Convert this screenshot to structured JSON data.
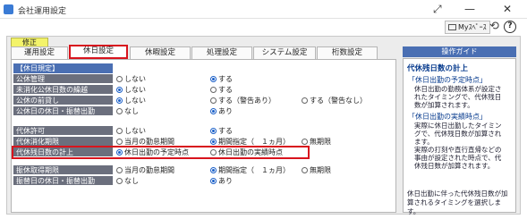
{
  "window": {
    "title": "会社運用設定",
    "myspace_label": "Myｽﾍﾟｰｽ",
    "help_label": "?"
  },
  "edit_badge": "修正",
  "tabs": [
    {
      "label": "運用設定",
      "active": false
    },
    {
      "label": "休日設定",
      "active": true
    },
    {
      "label": "休暇設定",
      "active": false
    },
    {
      "label": "処理設定",
      "active": false
    },
    {
      "label": "システム設定",
      "active": false
    },
    {
      "label": "桁数設定",
      "active": false
    }
  ],
  "section1_header": "【休日規定】",
  "rows": [
    {
      "label": "公休管理",
      "options": [
        "しない",
        "する"
      ],
      "selected": 1
    },
    {
      "label": "未消化公休日数の繰越",
      "options": [
        "しない",
        "する"
      ],
      "selected": 0
    },
    {
      "label": "公休の前貸し",
      "options": [
        "しない",
        "する（警告あり）",
        "する（警告なし）"
      ],
      "selected": 0
    },
    {
      "label": "公休日の休日・振替出勤",
      "options": [
        "なし",
        "あり"
      ],
      "selected": 1
    },
    {
      "label": "代休許可",
      "options": [
        "しない",
        "する"
      ],
      "selected": 1
    },
    {
      "label": "代休消化期限",
      "options": [
        "当月の勤怠期間",
        "期間指定（　１ヵ月）",
        "無期限"
      ],
      "selected": 1
    },
    {
      "label": "代休残日数の計上",
      "options": [
        "休日出勤の予定時点",
        "休日出勤の実績時点"
      ],
      "selected": 0
    },
    {
      "label": "振休取得期限",
      "options": [
        "当月の勤怠期間",
        "期間指定（　１ヵ月）",
        "無期限"
      ],
      "selected": 1
    },
    {
      "label": "振替日の休日・振替出勤",
      "options": [
        "なし",
        "あり"
      ],
      "selected": 1
    }
  ],
  "guide": {
    "title": "操作ガイド",
    "heading": "代休残日数の計上",
    "sub1": "「休日出勤の予定時点」",
    "body1": [
      "休日出勤の勤務体系が設定さ",
      "れたタイミングで、代休残日",
      "数が加算されます。"
    ],
    "sub2": "「休日出勤の実績時点」",
    "body2": [
      "実際に休日出勤したタイミン",
      "グで、代休残日数が加算され",
      "ます。",
      "実際の打刻や直行直帰などの",
      "事由が設定された時点で、代",
      "休残日数が加算されます。"
    ],
    "footer": [
      "休日出勤に伴った代休残日数が加",
      "算されるタイミングを選択しま",
      "す。"
    ]
  },
  "colors": {
    "accent": "#4a6fb3",
    "label_bg": "#6b6f7d",
    "highlight": "#d8141d",
    "badge": "#f3f36a"
  }
}
